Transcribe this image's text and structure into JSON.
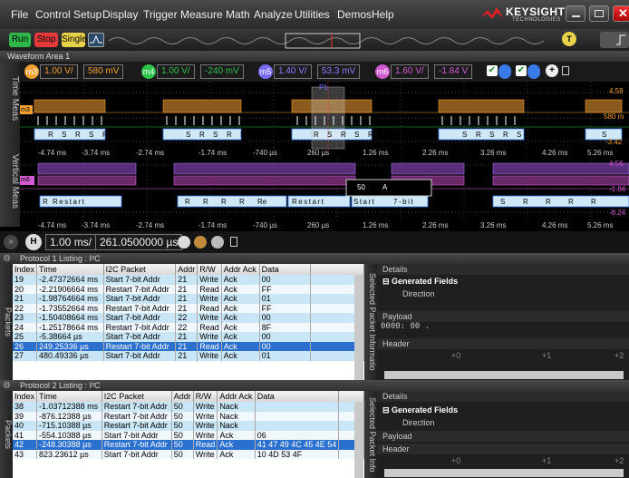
{
  "menu": [
    "File",
    "Control",
    "Setup",
    "Display",
    "Trigger",
    "Measure",
    "Math",
    "Analyze",
    "Utilities",
    "Demos",
    "Help"
  ],
  "logo": {
    "brand": "KEYSIGHT",
    "sub": "TECHNOLOGIES"
  },
  "toolbar": {
    "run": "Run",
    "stop": "Stop",
    "single": "Single",
    "trigger_marker": "T"
  },
  "waveform_area_title": "Waveform Area 1",
  "side_tabs": {
    "time": "Time Meas",
    "vertical": "Vertical Meas"
  },
  "channels": [
    {
      "id": "m3",
      "scale": "1.00 V/",
      "offset": "580 mV",
      "color": "#f0a030"
    },
    {
      "id": "m4",
      "scale": "1.00 V/",
      "offset": "-240 mV",
      "color": "#2ec24a"
    },
    {
      "id": "m5",
      "scale": "1.40 V/",
      "offset": "53.3 mV",
      "color": "#7a6cff"
    },
    {
      "id": "m6",
      "scale": "1.60 V/",
      "offset": "-1.84 V",
      "color": "#d05ad0"
    }
  ],
  "plot1": {
    "right_labels": [
      "4.58",
      "580 m",
      "-3.42"
    ],
    "time_ticks": [
      "-4.74 ms",
      "-3.74 ms",
      "-2.74 ms",
      "-1.74 ms",
      "-740 µs",
      "260 µs",
      "1.26 ms",
      "2.26 ms",
      "3.26 ms",
      "4.26 ms",
      "5.26 ms"
    ],
    "decode": [
      "R",
      "S",
      "R",
      "S",
      "R",
      "S",
      "R",
      "S",
      "R",
      "S",
      "R",
      "S",
      "R",
      "S",
      "R",
      "S",
      "R",
      "S",
      "R",
      "S",
      "S"
    ],
    "p1": "P1"
  },
  "plot2": {
    "right_labels": [
      "4.56",
      "-1.84",
      "-8.24"
    ],
    "time_ticks": [
      "-4.74 ms",
      "-3.74 ms",
      "-2.74 ms",
      "-1.74 ms",
      "-740 µs",
      "260 µs",
      "1.26 ms",
      "2.26 ms",
      "3.26 ms",
      "4.26 ms",
      "5.26 ms"
    ],
    "decode": [
      "R",
      "Restart",
      "R",
      "R",
      "R",
      "R",
      "Re",
      "Restart",
      "50",
      "A",
      "Start",
      "7-bit",
      "S",
      "R",
      "R",
      "R",
      "R"
    ]
  },
  "horizontal": {
    "h": "H",
    "scale": "1.00 ms/",
    "position": "261.0500000 µs"
  },
  "protocol1": {
    "title": "Protocol 1 Listing : I²C",
    "headers": [
      "Index",
      "Time",
      "I2C Packet",
      "Addr",
      "R/W",
      "Addr Ack",
      "Data"
    ],
    "rows": [
      [
        "19",
        "-2.47372664 ms",
        "Start 7-bit Addr",
        "21",
        "Write",
        "Ack",
        "00"
      ],
      [
        "20",
        "-2.21906664 ms",
        "Restart 7-bit Addr",
        "21",
        "Read",
        "Ack",
        "FF"
      ],
      [
        "21",
        "-1.98764664 ms",
        "Start 7-bit Addr",
        "21",
        "Write",
        "Ack",
        "01"
      ],
      [
        "22",
        "-1.73552664 ms",
        "Restart 7-bit Addr",
        "21",
        "Read",
        "Ack",
        "FF"
      ],
      [
        "23",
        "-1.50408664 ms",
        "Start 7-bit Addr",
        "22",
        "Write",
        "Ack",
        "00"
      ],
      [
        "24",
        "-1.25178664 ms",
        "Restart 7-bit Addr",
        "22",
        "Read",
        "Ack",
        "8F"
      ],
      [
        "25",
        "-5.38664 µs",
        "Start 7-bit Addr",
        "21",
        "Write",
        "Ack",
        "00"
      ],
      [
        "26",
        "249.25336 µs",
        "Restart 7-bit Addr",
        "21",
        "Read",
        "Ack",
        "00"
      ],
      [
        "27",
        "480.49336 µs",
        "Start 7-bit Addr",
        "21",
        "Write",
        "Ack",
        "01"
      ]
    ],
    "selected_index": 7,
    "details": {
      "title": "Details",
      "generated": "Generated Fields",
      "direction": "Direction",
      "payload": "Payload",
      "payload_row": "0000:  00   .",
      "header": "Header",
      "ruler": [
        "+0",
        "+1",
        "+2"
      ]
    },
    "side": "Selected Packet Informatio"
  },
  "protocol2": {
    "title": "Protocol 2 Listing : I²C",
    "headers": [
      "Index",
      "Time",
      "I2C Packet",
      "Addr",
      "R/W",
      "Addr Ack",
      "Data"
    ],
    "rows": [
      [
        "38",
        "-1.03712388 ms",
        "Restart 7-bit Addr",
        "50",
        "Write",
        "Nack",
        ""
      ],
      [
        "39",
        "-876.12388 µs",
        "Restart 7-bit Addr",
        "50",
        "Write",
        "Nack",
        ""
      ],
      [
        "40",
        "-715.10388 µs",
        "Restart 7-bit Addr",
        "50",
        "Write",
        "Nack",
        ""
      ],
      [
        "41",
        "-554.10388 µs",
        "Start 7-bit Addr",
        "50",
        "Write",
        "Ack",
        "06"
      ],
      [
        "42",
        "-248.30388 µs",
        "Restart 7-bit Addr",
        "50",
        "Read",
        "Ack",
        "41 47 49 4C 45 4E 54"
      ],
      [
        "43",
        "823.23612 µs",
        "Start 7-bit Addr",
        "50",
        "Write",
        "Ack",
        "10 4D 53 4F"
      ]
    ],
    "selected_index": 4,
    "details": {
      "title": "Details",
      "generated": "Generated Fields",
      "direction": "Direction",
      "payload": "Payload",
      "header": "Header",
      "ruler": [
        "+0",
        "+1",
        "+2"
      ]
    },
    "side": "Selected Packet Info"
  },
  "side_packets": "Packets"
}
